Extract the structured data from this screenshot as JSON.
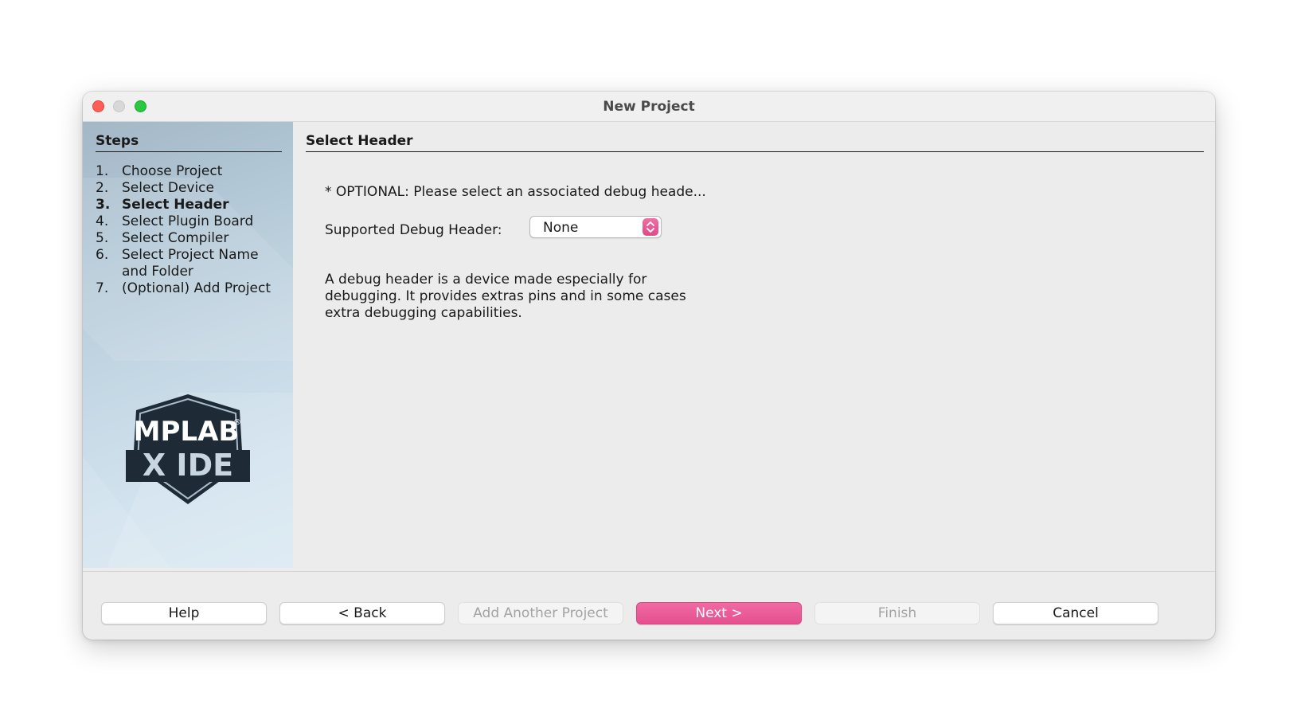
{
  "window": {
    "title": "New Project"
  },
  "steps": {
    "title": "Steps",
    "items": [
      {
        "num": "1.",
        "label": "Choose Project"
      },
      {
        "num": "2.",
        "label": "Select Device"
      },
      {
        "num": "3.",
        "label": "Select Header"
      },
      {
        "num": "4.",
        "label": "Select Plugin Board"
      },
      {
        "num": "5.",
        "label": "Select Compiler"
      },
      {
        "num": "6.",
        "label": "Select Project Name and Folder"
      },
      {
        "num": "7.",
        "label": "(Optional) Add Project"
      }
    ],
    "current_index": 2
  },
  "logo": {
    "line1": "MPLAB",
    "registered": "®",
    "line2": "X IDE"
  },
  "main": {
    "section_title": "Select Header",
    "optional_text": "* OPTIONAL: Please select an associated debug heade...",
    "field_label": "Supported Debug Header:",
    "select_value": "None",
    "description": "A debug header is a device made especially for debugging. It provides extras pins and in some cases extra debugging capabilities."
  },
  "buttons": {
    "help": "Help",
    "back": "< Back",
    "add_another": "Add Another Project",
    "next": "Next >",
    "finish": "Finish",
    "cancel": "Cancel"
  },
  "colors": {
    "accent": "#e5508f",
    "close": "#ff5f57",
    "zoom": "#28c840",
    "minimize_inactive": "#d9d8d9"
  }
}
